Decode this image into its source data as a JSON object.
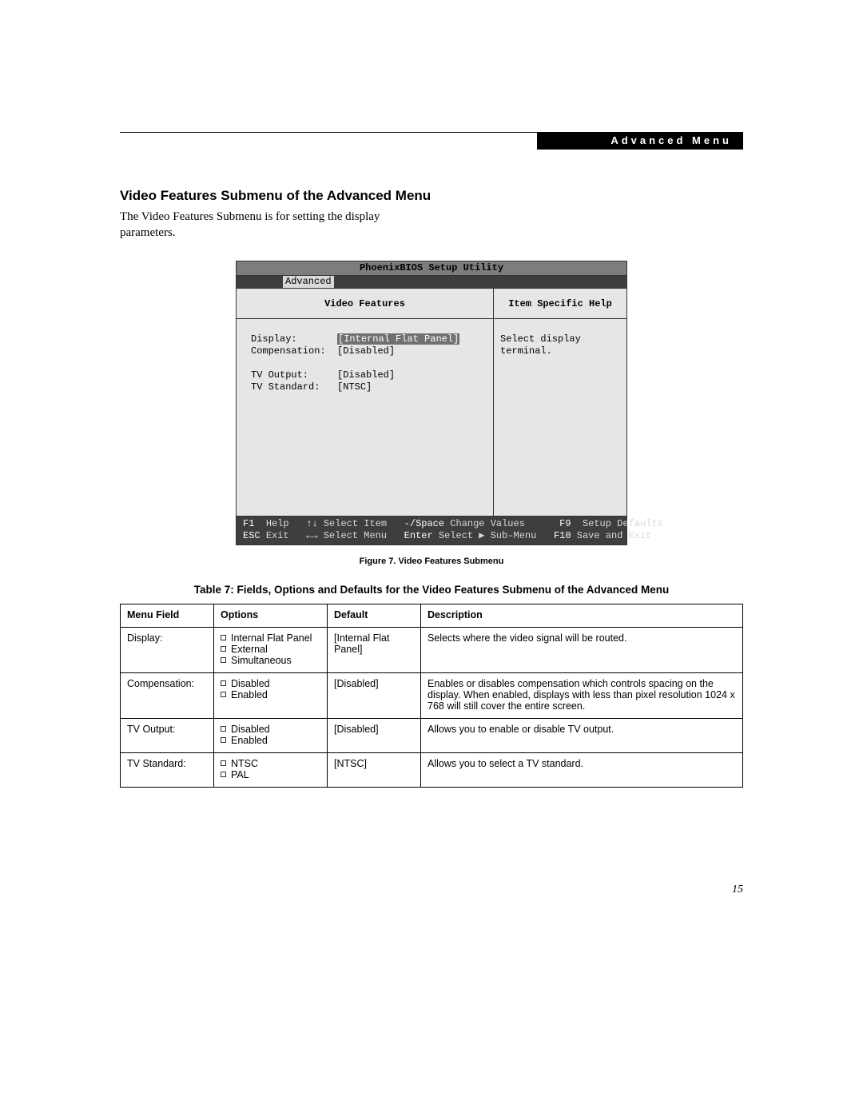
{
  "header_label": "Advanced Menu",
  "section_title": "Video Features Submenu of the Advanced Menu",
  "intro_text": "The Video Features Submenu is for setting the display parameters.",
  "bios": {
    "title": "PhoenixBIOS Setup Utility",
    "active_tab": "Advanced",
    "left_heading": "Video Features",
    "right_heading": "Item Specific Help",
    "help_text": "Select display terminal.",
    "rows": {
      "r1_label": "Display:",
      "r1_value": "[Internal Flat Panel]",
      "r2_label": "Compensation:",
      "r2_value": "[Disabled]",
      "r3_label": "TV Output:",
      "r3_value": "[Disabled]",
      "r4_label": "TV Standard:",
      "r4_value": "[NTSC]"
    },
    "footer": {
      "f1": "F1",
      "help": "Help",
      "esc": "ESC",
      "exit": "Exit",
      "sel_item": "Select Item",
      "sel_menu": "Select Menu",
      "chg": "Change Values",
      "sub": "Select ▶ Sub-Menu",
      "f9": "F9",
      "defaults": "Setup Defaults",
      "f10": "F10",
      "save": "Save and Exit",
      "minus_space": "-/Space",
      "enter": "Enter",
      "updown": "↑↓",
      "leftright": "←→"
    }
  },
  "figure_caption": "Figure 7.  Video Features Submenu",
  "table_title": "Table 7: Fields, Options and Defaults for the Video Features Submenu of the Advanced Menu",
  "table": {
    "head": {
      "c1": "Menu Field",
      "c2": "Options",
      "c3": "Default",
      "c4": "Description"
    },
    "rows": [
      {
        "field": "Display:",
        "options": [
          "Internal Flat Panel",
          "External",
          "Simultaneous"
        ],
        "default": "[Internal Flat Panel]",
        "desc": "Selects where the video signal will be routed."
      },
      {
        "field": "Compensation:",
        "options": [
          "Disabled",
          "Enabled"
        ],
        "default": "[Disabled]",
        "desc": "Enables or disables compensation which controls spacing on the display. When enabled, displays with less than pixel resolution 1024 x 768 will still cover the entire screen."
      },
      {
        "field": "TV Output:",
        "options": [
          "Disabled",
          "Enabled"
        ],
        "default": "[Disabled]",
        "desc": "Allows you to enable or disable TV output."
      },
      {
        "field": "TV Standard:",
        "options": [
          "NTSC",
          "PAL"
        ],
        "default": "[NTSC]",
        "desc": "Allows you to select a TV standard."
      }
    ]
  },
  "page_number": "15"
}
